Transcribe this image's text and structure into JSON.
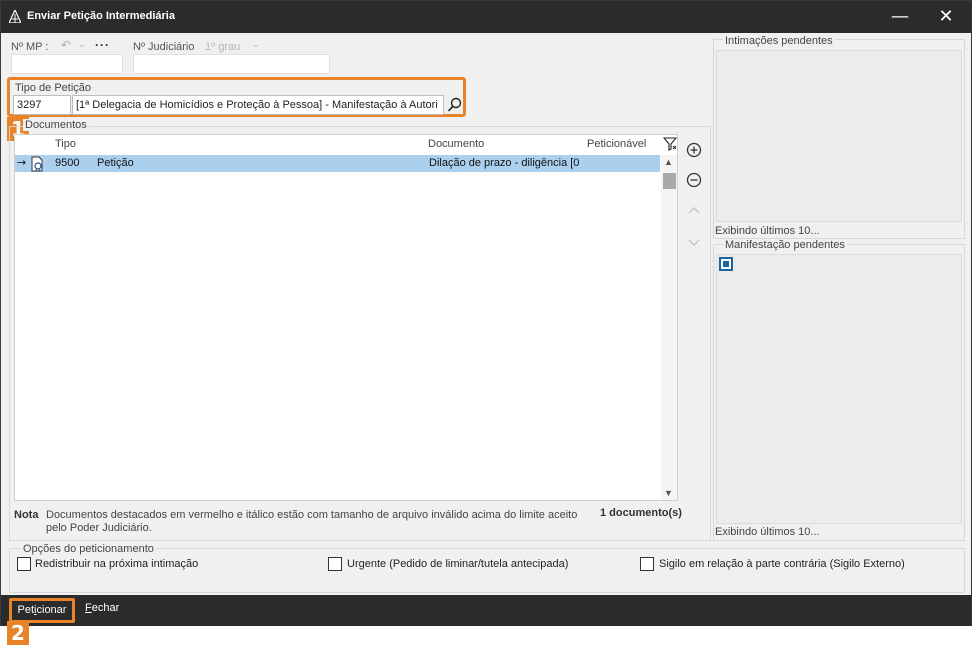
{
  "window": {
    "title": "Enviar Petição Intermediária",
    "minimize_glyph": "—",
    "close_glyph": "✕"
  },
  "header": {
    "mp_label": "Nº MP :",
    "mp_back_glyph": "↶",
    "mp_caret_glyph": "⌄",
    "mp_more_glyph": "···",
    "mp_value": "",
    "judiciario_label": "Nº Judiciário",
    "grau_label": "1º grau",
    "grau_caret_glyph": "⌄",
    "judiciario_value": ""
  },
  "tipo_peticao": {
    "label": "Tipo de Petição",
    "code": "3297",
    "description": "[1ª Delegacia de Homicídios e Proteção à Pessoa] - Manifestação à Autori",
    "highlight_color": "#e8832a"
  },
  "annotations": {
    "marker_1": "1",
    "marker_2": "2"
  },
  "documentos": {
    "group_label": "Documentos",
    "columns": {
      "tipo": "Tipo",
      "documento": "Documento",
      "peticionavel": "Peticionável"
    },
    "rows": [
      {
        "indicator": "→",
        "code": "9500",
        "name": "Petição",
        "documento": "Dilação de prazo - diligência [0",
        "selected_color": "#aad0ee"
      }
    ],
    "nota_label": "Nota",
    "nota_text": "Documentos destacados em vermelho e itálico estão com tamanho de arquivo inválido acima do limite aceito pelo Poder Judiciário.",
    "count": "1 documento(s)"
  },
  "opcoes": {
    "group_label": "Opções do peticionamento",
    "redistribuir": "Redistribuir na próxima intimação",
    "urgente": "Urgente (Pedido de liminar/tutela antecipada)",
    "sigilo": "Sigilo em relação à parte contrária (Sigilo Externo)"
  },
  "intimacoes": {
    "label": "Intimações pendentes",
    "footer": "Exibindo últimos 10..."
  },
  "manifestacoes": {
    "label": "Manifestação pendentes",
    "footer": "Exibindo últimos 10..."
  },
  "footer": {
    "peticionar_pre": "Pet",
    "peticionar_u": "i",
    "peticionar_post": "cionar",
    "fechar_u": "F",
    "fechar_post": "echar"
  },
  "icons": {
    "logo": "app-logo-icon",
    "search": "search-icon",
    "filter": "filter-icon",
    "document": "document-seal-icon",
    "add": "add-circle-icon",
    "remove": "remove-circle-icon",
    "up": "chevron-up-icon",
    "down": "chevron-down-icon"
  }
}
